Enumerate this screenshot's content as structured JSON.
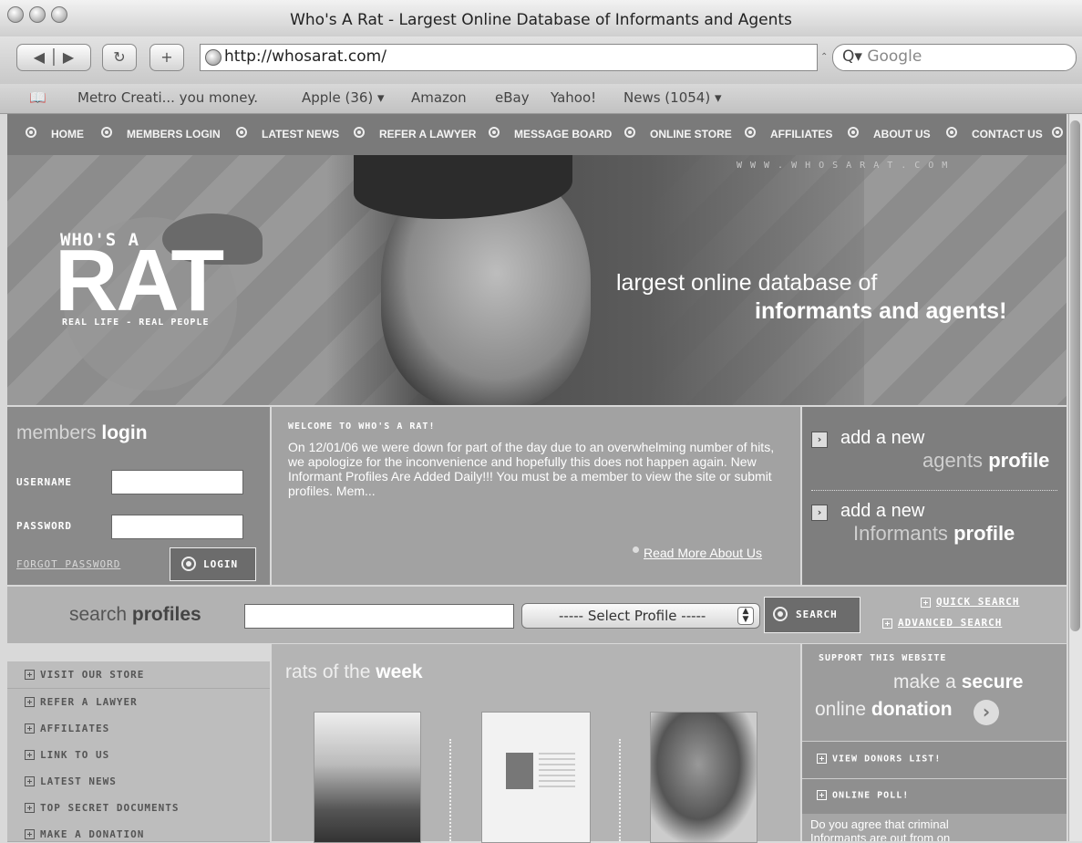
{
  "window": {
    "title": "Who's A Rat - Largest Online Database of Informants and Agents"
  },
  "toolbar": {
    "back_icon": "back-forward-arrows",
    "reload_icon": "reload-icon",
    "add_icon": "plus-icon",
    "url": "http://whosarat.com/",
    "search_placeholder": "Google",
    "search_prefix": "Q▾"
  },
  "bookmarks": {
    "icon": "book-icon",
    "items": [
      "Metro Creati... you money.",
      "Apple (36) ▾",
      "Amazon",
      "eBay",
      "Yahoo!",
      "News (1054) ▾"
    ]
  },
  "nav": {
    "items": [
      "HOME",
      "MEMBERS LOGIN",
      "LATEST NEWS",
      "REFER A LAWYER",
      "MESSAGE BOARD",
      "ONLINE STORE",
      "AFFILIATES",
      "ABOUT US",
      "CONTACT US"
    ]
  },
  "banner": {
    "logo_top": "WHO'S A",
    "logo_main": "RAT",
    "logo_sub": "REAL LIFE - REAL PEOPLE",
    "url_watermark": "WWW.WHOSARAT.COM",
    "tagline_1": "largest online database of",
    "tagline_2": "informants and agents!"
  },
  "login": {
    "title_light": "members",
    "title_bold": "login",
    "username_label": "USERNAME",
    "password_label": "PASSWORD",
    "forgot_label": "FORGOT PASSWORD",
    "login_button": "LOGIN"
  },
  "welcome": {
    "heading": "WELCOME TO WHO'S A RAT!",
    "body": "On 12/01/06 we were down for part of the day due to an overwhelming number of hits, we apologize for the inconvenience and hopefully this does not happen again. New Informant Profiles Are Added Daily!!! You must be a member to view the site or submit profiles. Mem...",
    "read_more": "Read More About Us"
  },
  "add_profile": {
    "agents": {
      "line1": "add a new",
      "light": "agents",
      "bold": "profile"
    },
    "informants": {
      "line1": "add a new",
      "light": "Informants",
      "bold": "profile"
    }
  },
  "search": {
    "title_light": "search",
    "title_bold": "profiles",
    "select_value": "----- Select Profile -----",
    "button": "SEARCH",
    "quick": "QUICK SEARCH",
    "advanced": "ADVANCED SEARCH"
  },
  "sidebar": {
    "links": [
      "VISIT OUR STORE",
      "REFER A LAWYER",
      "AFFILIATES",
      "LINK TO US",
      "LATEST NEWS",
      "TOP SECRET DOCUMENTS",
      "MAKE A DONATION"
    ]
  },
  "rats": {
    "title_light": "rats of the",
    "title_bold": "week"
  },
  "support": {
    "heading": "SUPPORT THIS WEBSITE",
    "line1_light": "make a",
    "line1_bold": "secure",
    "line2_light": "online",
    "line2_bold": "donation",
    "donors": "VIEW DONORS LIST!",
    "poll": "ONLINE POLL!",
    "poll_question": "Do you agree that criminal Informants are out from on"
  }
}
